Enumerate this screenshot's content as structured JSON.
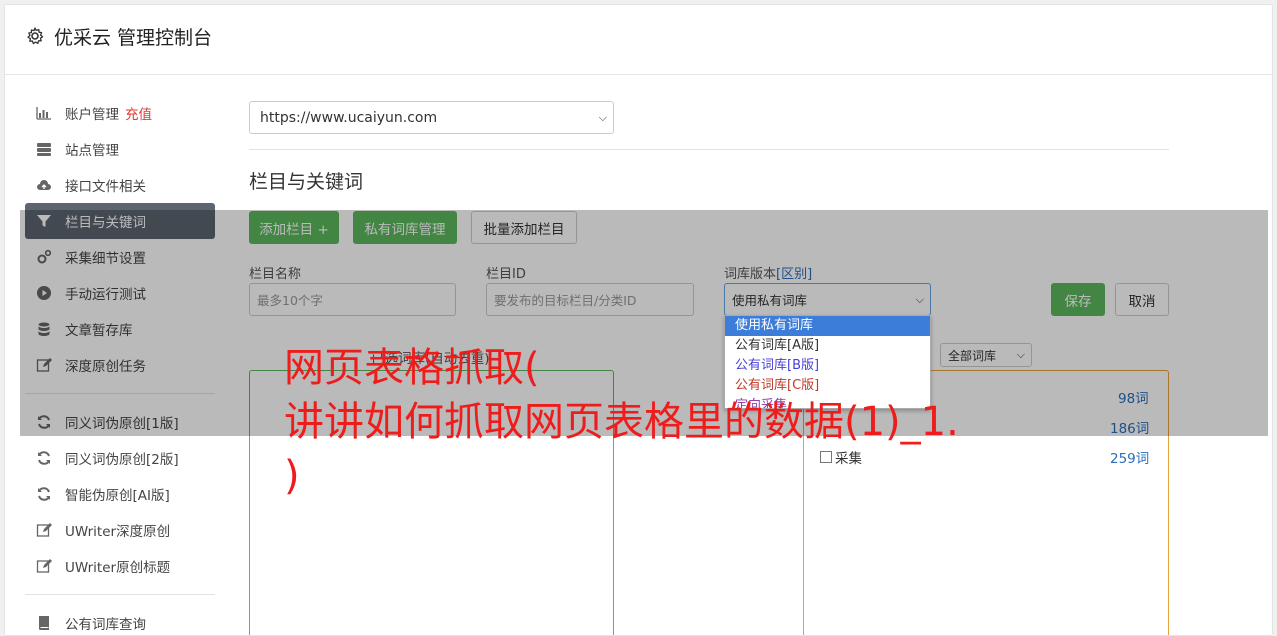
{
  "header": {
    "title": "优采云 管理控制台",
    "icon": "gear-icon"
  },
  "sidebar": {
    "items": [
      {
        "label": "账户管理",
        "badge": "充值",
        "icon": "bar-chart-icon"
      },
      {
        "label": "站点管理",
        "icon": "server-icon"
      },
      {
        "label": "接口文件相关",
        "icon": "cloud-upload-icon"
      },
      {
        "label": "栏目与关键词",
        "icon": "filter-icon",
        "active": true
      },
      {
        "label": "采集细节设置",
        "icon": "cogs-icon"
      },
      {
        "label": "手动运行测试",
        "icon": "play-circle-icon"
      },
      {
        "label": "文章暂存库",
        "icon": "database-icon"
      },
      {
        "label": "深度原创任务",
        "icon": "edit-icon"
      }
    ],
    "items2": [
      {
        "label": "同义词伪原创[1版]",
        "icon": "refresh-icon"
      },
      {
        "label": "同义词伪原创[2版]",
        "icon": "refresh-icon"
      },
      {
        "label": "智能伪原创[AI版]",
        "icon": "refresh-icon"
      },
      {
        "label": "UWriter深度原创",
        "icon": "edit-icon"
      },
      {
        "label": "UWriter原创标题",
        "icon": "edit-icon"
      }
    ],
    "items3": [
      {
        "label": "公有词库查询",
        "icon": "book-icon"
      }
    ]
  },
  "main": {
    "site_select": "https://www.ucaiyun.com",
    "section_title": "栏目与关键词",
    "buttons": {
      "add": "添加栏目 +",
      "private": "私有词库管理",
      "batch": "批量添加栏目",
      "save": "保存",
      "cancel": "取消"
    },
    "form": {
      "name_label": "栏目名称",
      "name_placeholder": "最多10个字",
      "id_label": "栏目ID",
      "id_placeholder": "要发布的目标栏目/分类ID",
      "version_label": "词库版本",
      "version_link": "[区别]",
      "version_value": "使用私有词库"
    },
    "dropdown_options": [
      {
        "label": "使用私有词库",
        "color": "#ffffff",
        "selected": true
      },
      {
        "label": "公有词库[A版]",
        "color": "#333333"
      },
      {
        "label": "公有词库[B版]",
        "color": "#4a3fd6"
      },
      {
        "label": "公有词库[C版]",
        "color": "#c0392b"
      },
      {
        "label": "定向采集",
        "color": "#8e44ad"
      }
    ],
    "selected_words_title": "已选词库(自动去重)",
    "filter_select": "全部词库",
    "word_counts": [
      "98词",
      "186词",
      "259词"
    ],
    "list_last_item": "采集"
  },
  "watermark": {
    "line1": "网页表格抓取(",
    "line2": "讲讲如何抓取网页表格里的数据(1)_1.",
    "line3": ")"
  },
  "colors": {
    "green": "#5cb85c",
    "active_nav": "#5d6570",
    "red": "#ef1c1c",
    "link": "#2a6ebd"
  }
}
